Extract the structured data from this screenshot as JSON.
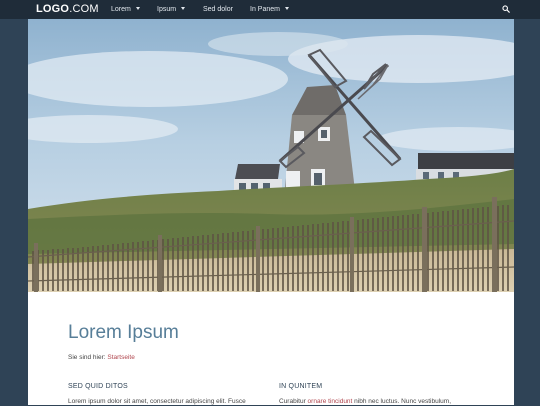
{
  "header": {
    "logo_main": "LOGO",
    "logo_suffix": ".COM",
    "nav": [
      {
        "label": "Lorem",
        "has_dropdown": true
      },
      {
        "label": "Ipsum",
        "has_dropdown": true
      },
      {
        "label": "Sed dolor",
        "has_dropdown": false
      },
      {
        "label": "In Panem",
        "has_dropdown": true
      }
    ],
    "search_icon": "search-icon"
  },
  "hero": {
    "image_subject": "windmill house behind a wooden dune fence"
  },
  "main": {
    "title": "Lorem Ipsum",
    "breadcrumb_prefix": "Sie sind hier:",
    "breadcrumb_link": "Startseite",
    "columns": [
      {
        "heading": "SED QUID DITOS",
        "text": "Lorem ipsum dolor sit amet, consectetur adipiscing elit. Fusce"
      },
      {
        "heading": "IN QUNITEM",
        "text_before": "Curabitur",
        "link": "ornare tincidunt",
        "text_after": "nibh nec luctus. Nunc vestibulum,"
      }
    ]
  },
  "colors": {
    "page_background": "#2f4356",
    "top_bar": "#1f2c39",
    "title": "#577e98",
    "link": "#b0464e"
  }
}
